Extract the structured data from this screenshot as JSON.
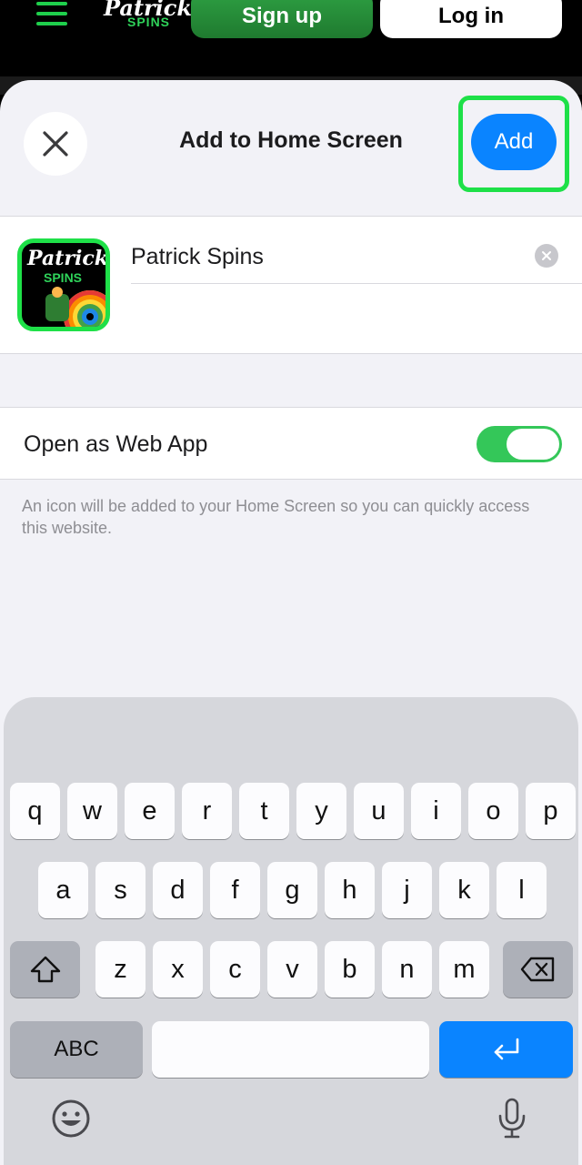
{
  "site": {
    "logo_line1": "Patrick",
    "logo_line2": "SPINS",
    "signup_label": "Sign up",
    "login_label": "Log in"
  },
  "sheet": {
    "title": "Add to Home Screen",
    "add_label": "Add",
    "app_name": "Patrick Spins",
    "icon_line1": "Patrick",
    "icon_line2": "SPINS",
    "webapp_label": "Open as Web App",
    "webapp_enabled": true,
    "footnote": "An icon will be added to your Home Screen so you can quickly access this website."
  },
  "keyboard": {
    "row1": [
      "q",
      "w",
      "e",
      "r",
      "t",
      "y",
      "u",
      "i",
      "o",
      "p"
    ],
    "row2": [
      "a",
      "s",
      "d",
      "f",
      "g",
      "h",
      "j",
      "k",
      "l"
    ],
    "row3": [
      "z",
      "x",
      "c",
      "v",
      "b",
      "n",
      "m"
    ],
    "abc_label": "ABC"
  },
  "colors": {
    "accent_green": "#1ee048",
    "ios_blue": "#0a84ff",
    "toggle_on": "#34c759"
  }
}
